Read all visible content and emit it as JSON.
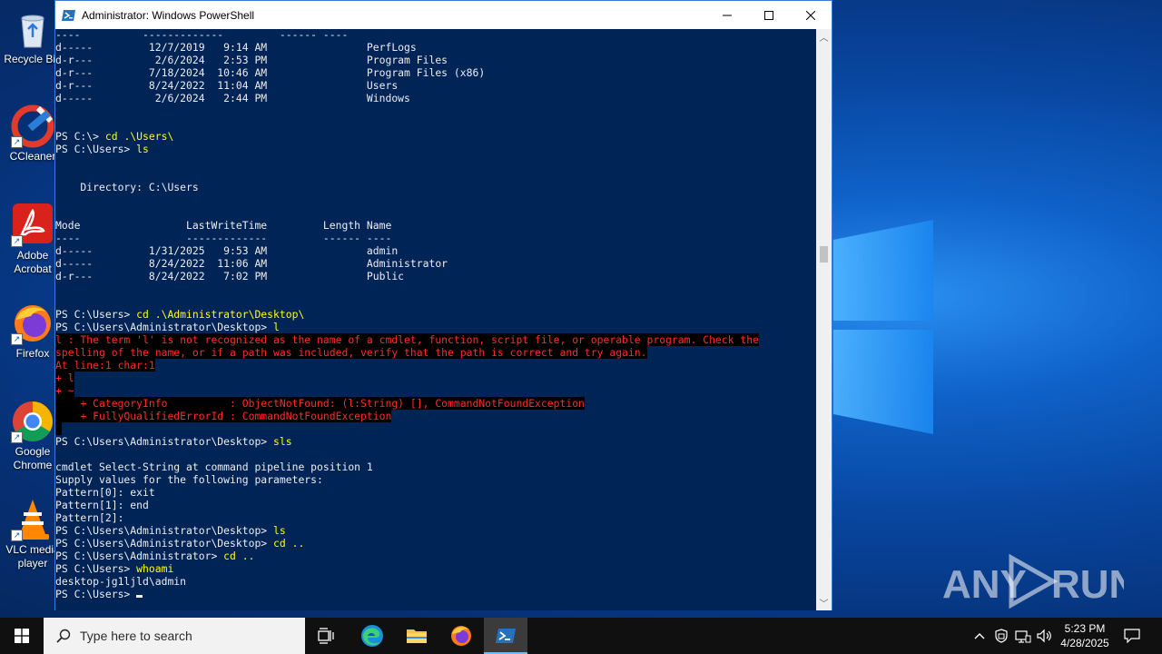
{
  "desktop": {
    "icons": [
      {
        "label": "Recycle Bin",
        "icon": "recycle-bin-icon"
      },
      {
        "label": "CCleaner",
        "icon": "ccleaner-icon"
      },
      {
        "label": "Adobe\nAcrobat",
        "icon": "adobe-acrobat-icon"
      },
      {
        "label": "Firefox",
        "icon": "firefox-icon"
      },
      {
        "label": "Google\nChrome",
        "icon": "chrome-icon"
      },
      {
        "label": "VLC media\nplayer",
        "icon": "vlc-icon"
      }
    ],
    "watermark": "ANY RUN"
  },
  "window": {
    "title": "Administrator: Windows PowerShell",
    "controls": {
      "minimize": "minimize-icon",
      "maximize": "maximize-icon",
      "close": "close-icon"
    }
  },
  "console": {
    "colors": {
      "background": "#012456",
      "text": "#eeedf0",
      "command": "#ffff00",
      "error": "#ff2b2b"
    },
    "lines": [
      {
        "text": "----          -------------         ------ ----",
        "kind": "normal"
      },
      {
        "text": "d-----         12/7/2019   9:14 AM                PerfLogs",
        "kind": "normal"
      },
      {
        "text": "d-r---          2/6/2024   2:53 PM                Program Files",
        "kind": "normal"
      },
      {
        "text": "d-r---         7/18/2024  10:46 AM                Program Files (x86)",
        "kind": "normal"
      },
      {
        "text": "d-r---         8/24/2022  11:04 AM                Users",
        "kind": "normal"
      },
      {
        "text": "d-----          2/6/2024   2:44 PM                Windows",
        "kind": "normal"
      },
      {
        "text": "",
        "kind": "normal"
      },
      {
        "text": "",
        "kind": "normal"
      },
      {
        "prompt": "PS C:\\> ",
        "command": "cd .\\Users\\",
        "kind": "prompt"
      },
      {
        "prompt": "PS C:\\Users> ",
        "command": "ls",
        "kind": "prompt"
      },
      {
        "text": "",
        "kind": "normal"
      },
      {
        "text": "",
        "kind": "normal"
      },
      {
        "text": "    Directory: C:\\Users",
        "kind": "normal"
      },
      {
        "text": "",
        "kind": "normal"
      },
      {
        "text": "",
        "kind": "normal"
      },
      {
        "text": "Mode                 LastWriteTime         Length Name",
        "kind": "normal"
      },
      {
        "text": "----                 -------------         ------ ----",
        "kind": "normal"
      },
      {
        "text": "d-----         1/31/2025   9:53 AM                admin",
        "kind": "normal"
      },
      {
        "text": "d-----         8/24/2022  11:06 AM                Administrator",
        "kind": "normal"
      },
      {
        "text": "d-r---         8/24/2022   7:02 PM                Public",
        "kind": "normal"
      },
      {
        "text": "",
        "kind": "normal"
      },
      {
        "text": "",
        "kind": "normal"
      },
      {
        "prompt": "PS C:\\Users> ",
        "command": "cd .\\Administrator\\Desktop\\",
        "kind": "prompt"
      },
      {
        "prompt": "PS C:\\Users\\Administrator\\Desktop> ",
        "command": "l",
        "kind": "prompt"
      },
      {
        "text": "l : The term 'l' is not recognized as the name of a cmdlet, function, script file, or operable program. Check the",
        "kind": "error"
      },
      {
        "text": "spelling of the name, or if a path was included, verify that the path is correct and try again.",
        "kind": "error"
      },
      {
        "text": "At line:1 char:1",
        "kind": "error"
      },
      {
        "text": "+ l",
        "kind": "error"
      },
      {
        "text": "+ ~",
        "kind": "error"
      },
      {
        "text": "    + CategoryInfo          : ObjectNotFound: (l:String) [], CommandNotFoundException",
        "kind": "error"
      },
      {
        "text": "    + FullyQualifiedErrorId : CommandNotFoundException",
        "kind": "error"
      },
      {
        "text": " ",
        "kind": "error"
      },
      {
        "prompt": "PS C:\\Users\\Administrator\\Desktop> ",
        "command": "sls",
        "kind": "prompt"
      },
      {
        "text": "",
        "kind": "normal"
      },
      {
        "text": "cmdlet Select-String at command pipeline position 1",
        "kind": "normal"
      },
      {
        "text": "Supply values for the following parameters:",
        "kind": "normal"
      },
      {
        "text": "Pattern[0]: exit",
        "kind": "normal"
      },
      {
        "text": "Pattern[1]: end",
        "kind": "normal"
      },
      {
        "text": "Pattern[2]:",
        "kind": "normal"
      },
      {
        "prompt": "PS C:\\Users\\Administrator\\Desktop> ",
        "command": "ls",
        "kind": "prompt"
      },
      {
        "prompt": "PS C:\\Users\\Administrator\\Desktop> ",
        "command": "cd ..",
        "kind": "prompt"
      },
      {
        "prompt": "PS C:\\Users\\Administrator> ",
        "command": "cd ..",
        "kind": "prompt"
      },
      {
        "prompt": "PS C:\\Users> ",
        "command": "whoami",
        "kind": "prompt"
      },
      {
        "text": "desktop-jg1ljld\\admin",
        "kind": "normal"
      },
      {
        "prompt": "PS C:\\Users> ",
        "command": "",
        "kind": "prompt",
        "cursor": true
      }
    ]
  },
  "taskbar": {
    "search_placeholder": "Type here to search",
    "apps": [
      {
        "name": "task-view",
        "icon": "task-view-icon"
      },
      {
        "name": "edge",
        "icon": "edge-icon"
      },
      {
        "name": "file-explorer",
        "icon": "folder-icon"
      },
      {
        "name": "firefox",
        "icon": "firefox-icon"
      },
      {
        "name": "powershell",
        "icon": "powershell-icon",
        "active": true
      }
    ],
    "tray_icons": [
      "chevron-up-icon",
      "security-icon",
      "network-icon",
      "volume-icon"
    ],
    "time": "5:23 PM",
    "date": "4/28/2025",
    "notification_icon": "notification-icon"
  }
}
